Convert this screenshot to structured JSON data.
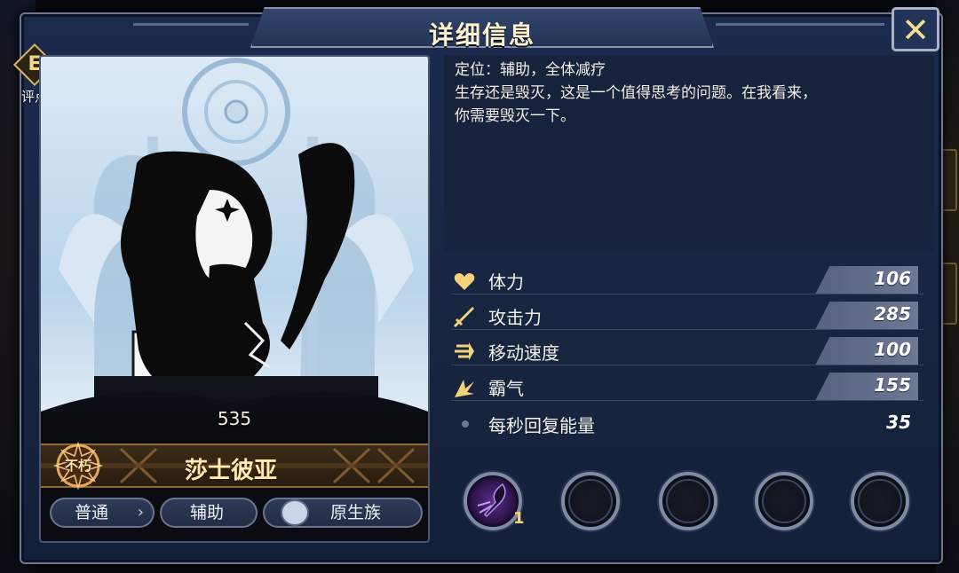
{
  "window": {
    "title": "详细信息",
    "close_icon": "close-icon",
    "rating_badge": {
      "letter": "E",
      "label": "评点"
    }
  },
  "hero": {
    "power": "535",
    "name": "莎士彼亚",
    "rarity_badge": "不朽",
    "tags": [
      {
        "label": "普通",
        "has_arrow": true
      },
      {
        "label": "辅助"
      },
      {
        "label": "原生族",
        "icon": "faction-icon"
      }
    ]
  },
  "description": {
    "line1": "定位：辅助，全体减疗",
    "line2": "生存还是毁灭，这是一个值得思考的问题。在我看来，",
    "line3": "你需要毁灭一下。"
  },
  "stats": [
    {
      "name": "体力",
      "value": "106",
      "icon": "heart-icon"
    },
    {
      "name": "攻击力",
      "value": "285",
      "icon": "sword-icon"
    },
    {
      "name": "移动速度",
      "value": "100",
      "icon": "speed-icon"
    },
    {
      "name": "霸气",
      "value": "155",
      "icon": "dominance-icon"
    },
    {
      "name": "每秒回复能量",
      "value": "35",
      "icon": "dot-icon"
    }
  ],
  "skills": [
    {
      "level": "1",
      "state": "unlocked"
    },
    {
      "state": "empty"
    },
    {
      "state": "empty"
    },
    {
      "state": "empty"
    },
    {
      "state": "empty"
    }
  ],
  "colors": {
    "panel_bg": "#1b2b4e",
    "gold": "#f2d78b",
    "stat_plate": "#6d7894"
  }
}
